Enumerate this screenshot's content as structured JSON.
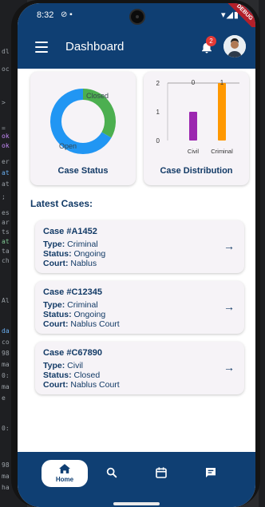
{
  "status_bar": {
    "time": "8:32",
    "debug_banner": "DEBUG"
  },
  "app_bar": {
    "title": "Dashboard",
    "notification_count": "2",
    "menu_icon": "menu-icon",
    "bell_icon": "bell-icon"
  },
  "cards": {
    "case_status": {
      "title": "Case Status"
    },
    "case_distribution": {
      "title": "Case Distribution"
    }
  },
  "chart_data": [
    {
      "type": "pie",
      "title": "Case Status",
      "slices": [
        {
          "label": "Closed",
          "value": 1,
          "color": "#4caf50"
        },
        {
          "label": "Open",
          "value": 2,
          "color": "#2196f3"
        }
      ]
    },
    {
      "type": "bar",
      "title": "Case Distribution",
      "categories": [
        "Civil",
        "Criminal"
      ],
      "values": [
        1,
        2
      ],
      "colors": [
        "#9c27b0",
        "#ff9800"
      ],
      "bar_labels": [
        "0",
        "1"
      ],
      "yticks": [
        "0",
        "1",
        "2"
      ],
      "ylim": [
        0,
        2
      ]
    }
  ],
  "latest_cases": {
    "title": "Latest Cases:",
    "labels": {
      "type": "Type:",
      "status": "Status:",
      "court": "Court:"
    },
    "items": [
      {
        "id": "Case #A1452",
        "type": "Criminal",
        "status": "Ongoing",
        "court": "Nablus"
      },
      {
        "id": "Case #C12345",
        "type": "Criminal",
        "status": "Ongoing",
        "court": "Nablus Court"
      },
      {
        "id": "Case #C67890",
        "type": "Civil",
        "status": "Closed",
        "court": "Nablus Court"
      }
    ]
  },
  "bottom_nav": {
    "home_label": "Home",
    "items": [
      "home-icon",
      "search-icon",
      "calendar-icon",
      "chat-icon"
    ]
  },
  "colors": {
    "primary": "#0f3f73",
    "card_bg": "#f6f3f7",
    "badge": "#e53935"
  }
}
